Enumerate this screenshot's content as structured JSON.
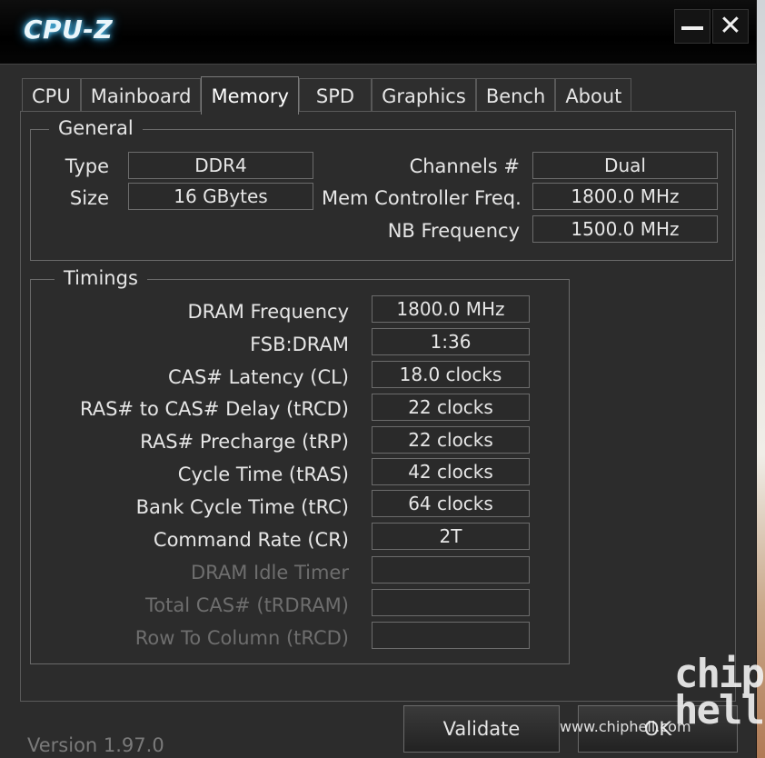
{
  "window": {
    "title": "CPU-Z",
    "controls": {
      "minimize_icon": "minimize-icon",
      "close_icon": "close-icon",
      "close_glyph": "✕"
    }
  },
  "tabs": [
    {
      "label": "CPU",
      "active": false
    },
    {
      "label": "Mainboard",
      "active": false
    },
    {
      "label": "Memory",
      "active": true
    },
    {
      "label": "SPD",
      "active": false
    },
    {
      "label": "Graphics",
      "active": false
    },
    {
      "label": "Bench",
      "active": false
    },
    {
      "label": "About",
      "active": false
    }
  ],
  "general": {
    "title": "General",
    "type_label": "Type",
    "type_value": "DDR4",
    "size_label": "Size",
    "size_value": "16 GBytes",
    "channels_label": "Channels #",
    "channels_value": "Dual",
    "mem_ctrl_label": "Mem Controller Freq.",
    "mem_ctrl_value": "1800.0 MHz",
    "nb_freq_label": "NB Frequency",
    "nb_freq_value": "1500.0 MHz"
  },
  "timings": {
    "title": "Timings",
    "rows": [
      {
        "label": "DRAM Frequency",
        "value": "1800.0 MHz",
        "enabled": true
      },
      {
        "label": "FSB:DRAM",
        "value": "1:36",
        "enabled": true
      },
      {
        "label": "CAS# Latency (CL)",
        "value": "18.0 clocks",
        "enabled": true
      },
      {
        "label": "RAS# to CAS# Delay (tRCD)",
        "value": "22 clocks",
        "enabled": true
      },
      {
        "label": "RAS# Precharge (tRP)",
        "value": "22 clocks",
        "enabled": true
      },
      {
        "label": "Cycle Time (tRAS)",
        "value": "42 clocks",
        "enabled": true
      },
      {
        "label": "Bank Cycle Time (tRC)",
        "value": "64 clocks",
        "enabled": true
      },
      {
        "label": "Command Rate (CR)",
        "value": "2T",
        "enabled": true
      },
      {
        "label": "DRAM Idle Timer",
        "value": "",
        "enabled": false
      },
      {
        "label": "Total CAS# (tRDRAM)",
        "value": "",
        "enabled": false
      },
      {
        "label": "Row To Column (tRCD)",
        "value": "",
        "enabled": false
      }
    ]
  },
  "footer": {
    "version": "Version 1.97.0",
    "validate_label": "Validate",
    "ok_label": "OK"
  },
  "watermark": {
    "url": "www.chiphell.com",
    "logo_line1": "chip",
    "logo_line2": "hell"
  }
}
